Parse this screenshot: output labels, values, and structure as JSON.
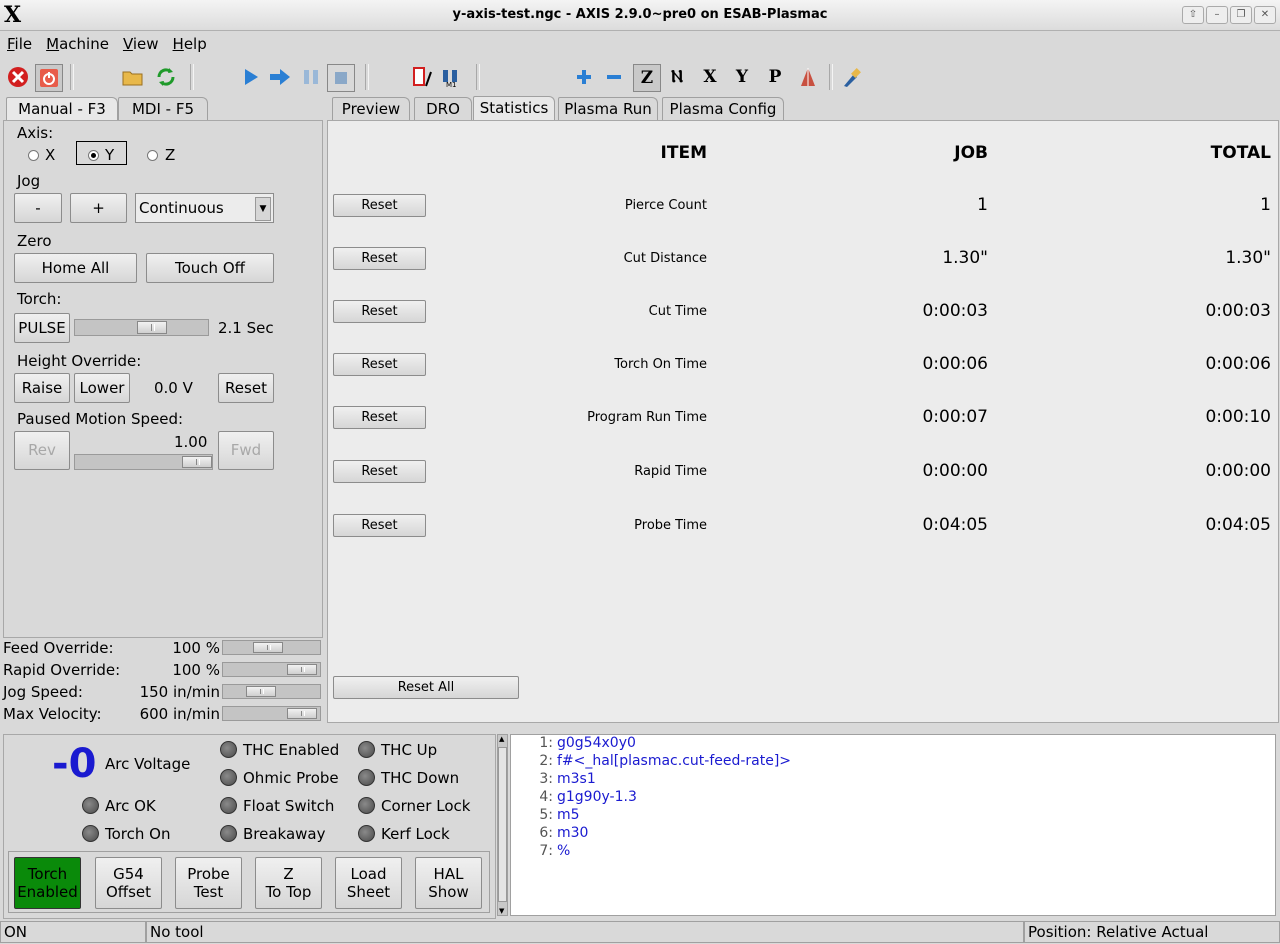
{
  "window": {
    "title": "y-axis-test.ngc - AXIS 2.9.0~pre0 on ESAB-Plasmac",
    "logo": "X"
  },
  "menu": [
    {
      "label": "File",
      "u": "F",
      "rest": "ile"
    },
    {
      "label": "Machine",
      "u": "M",
      "rest": "achine"
    },
    {
      "label": "View",
      "u": "V",
      "rest": "iew"
    },
    {
      "label": "Help",
      "u": "H",
      "rest": "elp"
    }
  ],
  "left_tabs": [
    "Manual - F3",
    "MDI - F5"
  ],
  "right_tabs": [
    "Preview",
    "DRO",
    "Statistics",
    "Plasma Run",
    "Plasma Config"
  ],
  "manual": {
    "axis_label": "Axis:",
    "axes": [
      "X",
      "Y",
      "Z"
    ],
    "selected_axis": "Y",
    "jog_label": "Jog",
    "jog_minus": "-",
    "jog_plus": "+",
    "jog_mode": "Continuous",
    "zero_label": "Zero",
    "home_all": "Home All",
    "touch_off": "Touch Off",
    "torch_label": "Torch:",
    "pulse": "PULSE",
    "pulse_time": "2.1 Sec",
    "pulse_level": 0.6,
    "height_label": "Height Override:",
    "raise": "Raise",
    "lower": "Lower",
    "height_value": "0.0 V",
    "height_reset": "Reset",
    "paused_label": "Paused Motion Speed:",
    "rev": "Rev",
    "fwd": "Fwd",
    "paused_value": "1.00",
    "paused_level": 1.0
  },
  "overrides": [
    {
      "label": "Feed Override:",
      "value": "100 %",
      "level": 0.45
    },
    {
      "label": "Rapid Override:",
      "value": "100 %",
      "level": 0.95
    },
    {
      "label": "Jog Speed:",
      "value": "150 in/min",
      "level": 0.35
    },
    {
      "label": "Max Velocity:",
      "value": "600 in/min",
      "level": 0.95
    }
  ],
  "stats": {
    "headers": {
      "item": "ITEM",
      "job": "JOB",
      "total": "TOTAL"
    },
    "reset_label": "Reset",
    "reset_all": "Reset All",
    "rows": [
      {
        "item": "Pierce Count",
        "job": "1",
        "total": "1"
      },
      {
        "item": "Cut Distance",
        "job": "1.30\"",
        "total": "1.30\""
      },
      {
        "item": "Cut Time",
        "job": "0:00:03",
        "total": "0:00:03"
      },
      {
        "item": "Torch On Time",
        "job": "0:00:06",
        "total": "0:00:06"
      },
      {
        "item": "Program Run Time",
        "job": "0:00:07",
        "total": "0:00:10"
      },
      {
        "item": "Rapid Time",
        "job": "0:00:00",
        "total": "0:00:00"
      },
      {
        "item": "Probe Time",
        "job": "0:04:05",
        "total": "0:04:05"
      }
    ]
  },
  "plasma": {
    "arc_voltage_value": "-0",
    "arc_voltage_label": "Arc Voltage",
    "leds": [
      "Arc OK",
      "Torch On",
      "THC Enabled",
      "Ohmic Probe",
      "Float Switch",
      "Breakaway",
      "THC Up",
      "THC Down",
      "Corner Lock",
      "Kerf Lock"
    ],
    "buttons": [
      {
        "l1": "Torch",
        "l2": "Enabled"
      },
      {
        "l1": "G54",
        "l2": "Offset"
      },
      {
        "l1": "Probe",
        "l2": "Test"
      },
      {
        "l1": "Z",
        "l2": "To Top"
      },
      {
        "l1": "Load",
        "l2": "Sheet"
      },
      {
        "l1": "HAL",
        "l2": "Show"
      }
    ]
  },
  "gcode": [
    {
      "n": "1:",
      "t": "g0g54x0y0"
    },
    {
      "n": "2:",
      "t": "f#<_hal[plasmac.cut-feed-rate]>"
    },
    {
      "n": "3:",
      "t": "m3s1"
    },
    {
      "n": "4:",
      "t": "g1g90y-1.3"
    },
    {
      "n": "5:",
      "t": "m5"
    },
    {
      "n": "6:",
      "t": "m30"
    },
    {
      "n": "7:",
      "t": "%"
    }
  ],
  "status": {
    "state": "ON",
    "tool": "No tool",
    "position": "Position: Relative Actual"
  },
  "colors": {
    "accent": "#1a1ad0",
    "torch_enabled": "#0a8a0a"
  }
}
